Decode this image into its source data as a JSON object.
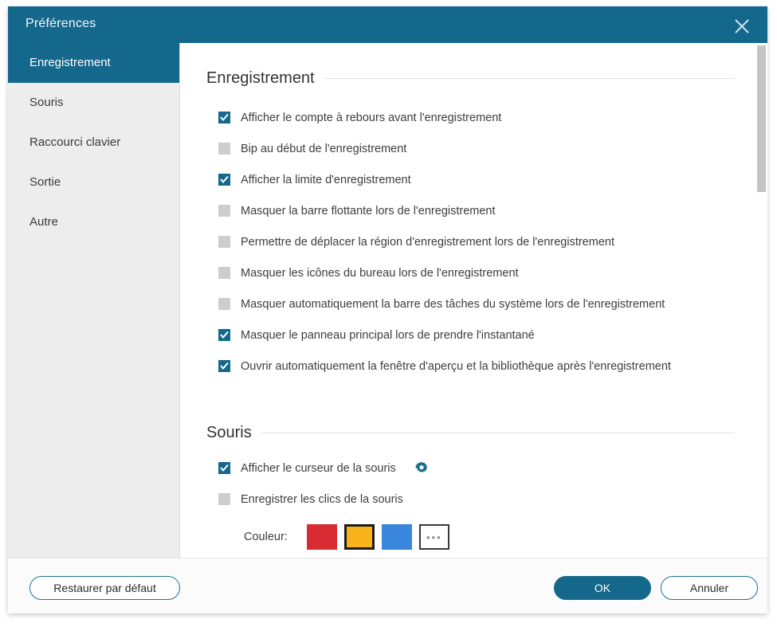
{
  "window": {
    "title": "Préférences",
    "close_icon": "close-icon"
  },
  "sidebar": {
    "items": [
      {
        "label": "Enregistrement",
        "selected": true
      },
      {
        "label": "Souris",
        "selected": false
      },
      {
        "label": "Raccourci clavier",
        "selected": false
      },
      {
        "label": "Sortie",
        "selected": false
      },
      {
        "label": "Autre",
        "selected": false
      }
    ]
  },
  "sections": [
    {
      "title": "Enregistrement",
      "options": [
        {
          "label": "Afficher le compte à rebours avant l'enregistrement",
          "checked": true
        },
        {
          "label": "Bip au début de l'enregistrement",
          "checked": false
        },
        {
          "label": "Afficher la limite d'enregistrement",
          "checked": true
        },
        {
          "label": "Masquer la barre flottante lors de l'enregistrement",
          "checked": false
        },
        {
          "label": "Permettre de déplacer la région d'enregistrement lors de l'enregistrement",
          "checked": false
        },
        {
          "label": "Masquer les icônes du bureau lors de l'enregistrement",
          "checked": false
        },
        {
          "label": "Masquer automatiquement la barre des tâches du système lors de l'enregistrement",
          "checked": false
        },
        {
          "label": "Masquer le panneau principal lors de prendre l'instantané",
          "checked": true
        },
        {
          "label": "Ouvrir automatiquement la fenêtre d'aperçu et la bibliothèque après l'enregistrement",
          "checked": true
        }
      ]
    },
    {
      "title": "Souris",
      "options": [
        {
          "label": "Afficher le curseur de la souris",
          "checked": true,
          "gear_icon": "gear-icon"
        },
        {
          "label": "Enregistrer les clics de la souris",
          "checked": false
        }
      ]
    }
  ],
  "color_picker": {
    "label": "Couleur:",
    "swatches": [
      {
        "name": "red",
        "hex": "#d92b33",
        "selected": false
      },
      {
        "name": "yellow",
        "hex": "#f9b41d",
        "selected": true
      },
      {
        "name": "blue",
        "hex": "#3b86dd",
        "selected": false
      }
    ],
    "more_label": "•••"
  },
  "footer": {
    "restore_label": "Restaurer par défaut",
    "ok_label": "OK",
    "cancel_label": "Annuler"
  },
  "theme": {
    "accent": "#14688c",
    "sidebar_bg": "#ededed",
    "checkbox_off": "#cdcdcd"
  }
}
